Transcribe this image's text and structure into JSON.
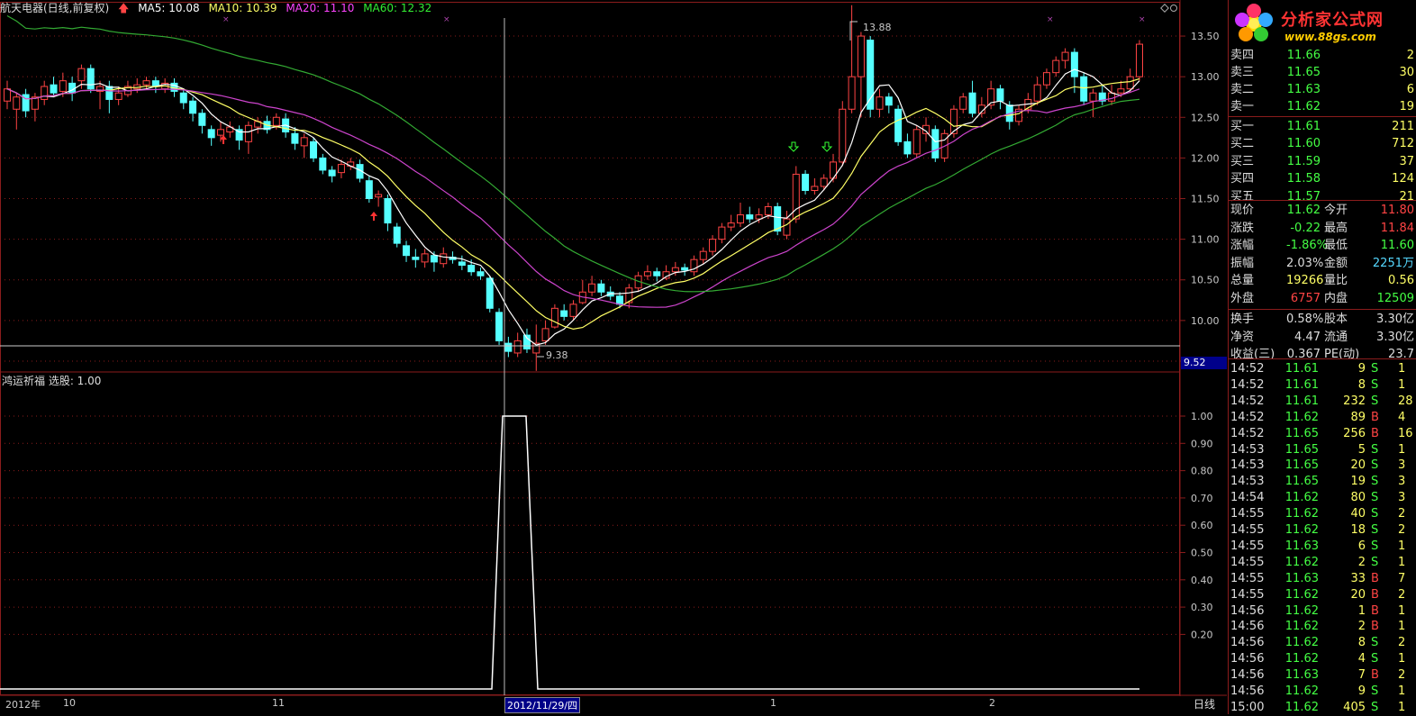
{
  "header": {
    "stock": "航天电器(日线,前复权)",
    "ma5": "MA5: 10.08",
    "ma10": "MA10: 10.39",
    "ma20": "MA20: 11.10",
    "ma60": "MA60: 12.32",
    "arrow_icon": "up-arrow-icon"
  },
  "main_axis": [
    "13.50",
    "13.00",
    "12.50",
    "12.00",
    "11.50",
    "11.00",
    "10.50",
    "10.00",
    "9.50"
  ],
  "current_price_tag": "9.52",
  "annotations": {
    "high": "13.88",
    "low": "9.38"
  },
  "sub_panel": {
    "title": "鸿运祈福 选股: 1.00",
    "axis": [
      "1.00",
      "0.90",
      "0.80",
      "0.70",
      "0.60",
      "0.50",
      "0.40",
      "0.30",
      "0.20"
    ]
  },
  "date_bar": {
    "year": "2012年",
    "m10": "10",
    "m11": "11",
    "selected": "2012/11/29/四",
    "m1": "1",
    "m2": "2",
    "period_button": "日线"
  },
  "logo": {
    "title": "分析家公式网",
    "url": "www.88gs.com"
  },
  "order_book": {
    "asks": [
      {
        "label": "卖四",
        "price": "11.66",
        "qty": "2"
      },
      {
        "label": "卖三",
        "price": "11.65",
        "qty": "30"
      },
      {
        "label": "卖二",
        "price": "11.63",
        "qty": "6"
      },
      {
        "label": "卖一",
        "price": "11.62",
        "qty": "19"
      }
    ],
    "bids": [
      {
        "label": "买一",
        "price": "11.61",
        "qty": "211"
      },
      {
        "label": "买二",
        "price": "11.60",
        "qty": "712"
      },
      {
        "label": "买三",
        "price": "11.59",
        "qty": "37"
      },
      {
        "label": "买四",
        "price": "11.58",
        "qty": "124"
      },
      {
        "label": "买五",
        "price": "11.57",
        "qty": "21"
      }
    ]
  },
  "quote": [
    {
      "k1": "现价",
      "v1": "11.62",
      "k2": "今开",
      "v2": "11.80"
    },
    {
      "k1": "涨跌",
      "v1": "-0.22",
      "k2": "最高",
      "v2": "11.84"
    },
    {
      "k1": "涨幅",
      "v1": "-1.86%",
      "k2": "最低",
      "v2": "11.60"
    },
    {
      "k1": "振幅",
      "v1": "2.03%",
      "k2": "金额",
      "v2": "2251万"
    },
    {
      "k1": "总量",
      "v1": "19266",
      "k2": "量比",
      "v2": "0.56"
    },
    {
      "k1": "外盘",
      "v1": "6757",
      "k2": "内盘",
      "v2": "12509"
    },
    {
      "k1": "换手",
      "v1": "0.58%",
      "k2": "股本",
      "v2": "3.30亿"
    },
    {
      "k1": "净资",
      "v1": "4.47",
      "k2": "流通",
      "v2": "3.30亿"
    },
    {
      "k1": "收益(三)",
      "v1": "0.367",
      "k2": "PE(动)",
      "v2": "23.7"
    }
  ],
  "ticks": [
    {
      "t": "14:52",
      "p": "11.61",
      "v": "9",
      "bs": "S",
      "n": "1"
    },
    {
      "t": "14:52",
      "p": "11.61",
      "v": "8",
      "bs": "S",
      "n": "1"
    },
    {
      "t": "14:52",
      "p": "11.61",
      "v": "232",
      "bs": "S",
      "n": "28"
    },
    {
      "t": "14:52",
      "p": "11.62",
      "v": "89",
      "bs": "B",
      "n": "4"
    },
    {
      "t": "14:52",
      "p": "11.65",
      "v": "256",
      "bs": "B",
      "n": "16"
    },
    {
      "t": "14:53",
      "p": "11.65",
      "v": "5",
      "bs": "S",
      "n": "1"
    },
    {
      "t": "14:53",
      "p": "11.65",
      "v": "20",
      "bs": "S",
      "n": "3"
    },
    {
      "t": "14:53",
      "p": "11.65",
      "v": "19",
      "bs": "S",
      "n": "3"
    },
    {
      "t": "14:54",
      "p": "11.62",
      "v": "80",
      "bs": "S",
      "n": "3"
    },
    {
      "t": "14:55",
      "p": "11.62",
      "v": "40",
      "bs": "S",
      "n": "2"
    },
    {
      "t": "14:55",
      "p": "11.62",
      "v": "18",
      "bs": "S",
      "n": "2"
    },
    {
      "t": "14:55",
      "p": "11.63",
      "v": "6",
      "bs": "S",
      "n": "1"
    },
    {
      "t": "14:55",
      "p": "11.62",
      "v": "2",
      "bs": "S",
      "n": "1"
    },
    {
      "t": "14:55",
      "p": "11.63",
      "v": "33",
      "bs": "B",
      "n": "7"
    },
    {
      "t": "14:55",
      "p": "11.62",
      "v": "20",
      "bs": "B",
      "n": "2"
    },
    {
      "t": "14:56",
      "p": "11.62",
      "v": "1",
      "bs": "B",
      "n": "1"
    },
    {
      "t": "14:56",
      "p": "11.62",
      "v": "2",
      "bs": "B",
      "n": "1"
    },
    {
      "t": "14:56",
      "p": "11.62",
      "v": "8",
      "bs": "S",
      "n": "2"
    },
    {
      "t": "14:56",
      "p": "11.62",
      "v": "4",
      "bs": "S",
      "n": "1"
    },
    {
      "t": "14:56",
      "p": "11.63",
      "v": "7",
      "bs": "B",
      "n": "2"
    },
    {
      "t": "14:56",
      "p": "11.62",
      "v": "9",
      "bs": "S",
      "n": "1"
    },
    {
      "t": "15:00",
      "p": "11.62",
      "v": "405",
      "bs": "S",
      "n": "1"
    }
  ],
  "chart_data": {
    "type": "candlestick",
    "ylim": [
      9.4,
      13.7
    ],
    "candles": [
      [
        12.7,
        12.85,
        12.95,
        12.6
      ],
      [
        12.6,
        12.75,
        12.8,
        12.35
      ],
      [
        12.78,
        12.58,
        12.85,
        12.5
      ],
      [
        12.6,
        12.75,
        12.8,
        12.45
      ],
      [
        12.72,
        12.88,
        12.95,
        12.65
      ],
      [
        12.9,
        12.8,
        13.0,
        12.75
      ],
      [
        12.82,
        12.95,
        13.05,
        12.75
      ],
      [
        12.92,
        12.8,
        13.0,
        12.7
      ],
      [
        12.95,
        13.1,
        13.15,
        12.85
      ],
      [
        13.1,
        12.85,
        13.15,
        12.8
      ],
      [
        12.82,
        12.88,
        12.95,
        12.6
      ],
      [
        12.88,
        12.72,
        12.95,
        12.55
      ],
      [
        12.72,
        12.8,
        12.88,
        12.65
      ],
      [
        12.78,
        12.88,
        12.95,
        12.75
      ],
      [
        12.85,
        12.9,
        12.98,
        12.8
      ],
      [
        12.9,
        12.95,
        13.0,
        12.85
      ],
      [
        12.95,
        12.88,
        13.0,
        12.8
      ],
      [
        12.85,
        12.92,
        12.98,
        12.8
      ],
      [
        12.92,
        12.82,
        12.98,
        12.75
      ],
      [
        12.8,
        12.68,
        12.85,
        12.6
      ],
      [
        12.7,
        12.55,
        12.75,
        12.45
      ],
      [
        12.55,
        12.4,
        12.6,
        12.3
      ],
      [
        12.35,
        12.25,
        12.4,
        12.15
      ],
      [
        12.28,
        12.35,
        12.45,
        12.2
      ],
      [
        12.32,
        12.38,
        12.45,
        12.25
      ],
      [
        12.35,
        12.22,
        12.4,
        12.1
      ],
      [
        12.2,
        12.4,
        12.45,
        12.05
      ],
      [
        12.38,
        12.45,
        12.5,
        12.3
      ],
      [
        12.45,
        12.35,
        12.52,
        12.3
      ],
      [
        12.4,
        12.5,
        12.55,
        12.35
      ],
      [
        12.48,
        12.32,
        12.55,
        12.25
      ],
      [
        12.3,
        12.18,
        12.38,
        12.1
      ],
      [
        12.15,
        12.25,
        12.3,
        12.0
      ],
      [
        12.2,
        12.0,
        12.25,
        11.95
      ],
      [
        12.0,
        11.85,
        12.05,
        11.8
      ],
      [
        11.85,
        11.78,
        11.9,
        11.7
      ],
      [
        11.82,
        11.92,
        11.98,
        11.75
      ],
      [
        11.9,
        11.95,
        12.0,
        11.85
      ],
      [
        11.92,
        11.75,
        11.98,
        11.7
      ],
      [
        11.72,
        11.5,
        11.78,
        11.45
      ],
      [
        11.52,
        11.55,
        11.6,
        11.4
      ],
      [
        11.5,
        11.2,
        11.55,
        11.1
      ],
      [
        11.15,
        10.95,
        11.2,
        10.9
      ],
      [
        10.92,
        10.8,
        10.98,
        10.72
      ],
      [
        10.78,
        10.75,
        10.88,
        10.65
      ],
      [
        10.72,
        10.82,
        10.88,
        10.65
      ],
      [
        10.8,
        10.72,
        10.85,
        10.6
      ],
      [
        10.7,
        10.82,
        10.9,
        10.65
      ],
      [
        10.78,
        10.75,
        10.85,
        10.7
      ],
      [
        10.72,
        10.68,
        10.8,
        10.62
      ],
      [
        10.68,
        10.6,
        10.75,
        10.55
      ],
      [
        10.6,
        10.55,
        10.65,
        10.5
      ],
      [
        10.52,
        10.15,
        10.55,
        10.1
      ],
      [
        10.1,
        9.75,
        10.15,
        9.7
      ],
      [
        9.72,
        9.62,
        9.8,
        9.55
      ],
      [
        9.6,
        9.75,
        9.85,
        9.55
      ],
      [
        9.82,
        9.65,
        9.9,
        9.6
      ],
      [
        9.6,
        9.72,
        9.95,
        9.38
      ],
      [
        9.75,
        9.9,
        10.0,
        9.7
      ],
      [
        9.92,
        10.15,
        10.2,
        9.9
      ],
      [
        10.12,
        10.05,
        10.2,
        10.0
      ],
      [
        10.05,
        10.2,
        10.25,
        10.0
      ],
      [
        10.22,
        10.35,
        10.5,
        10.2
      ],
      [
        10.35,
        10.45,
        10.55,
        10.3
      ],
      [
        10.45,
        10.35,
        10.5,
        10.3
      ],
      [
        10.35,
        10.3,
        10.42,
        10.25
      ],
      [
        10.3,
        10.2,
        10.35,
        10.15
      ],
      [
        10.22,
        10.4,
        10.45,
        10.15
      ],
      [
        10.4,
        10.55,
        10.6,
        10.35
      ],
      [
        10.55,
        10.6,
        10.68,
        10.5
      ],
      [
        10.6,
        10.55,
        10.65,
        10.48
      ],
      [
        10.52,
        10.6,
        10.68,
        10.5
      ],
      [
        10.6,
        10.65,
        10.72,
        10.55
      ],
      [
        10.65,
        10.62,
        10.7,
        10.55
      ],
      [
        10.6,
        10.75,
        10.8,
        10.55
      ],
      [
        10.75,
        10.85,
        10.9,
        10.7
      ],
      [
        10.85,
        11.0,
        11.05,
        10.8
      ],
      [
        11.0,
        11.15,
        11.2,
        10.95
      ],
      [
        11.15,
        11.2,
        11.3,
        11.1
      ],
      [
        11.2,
        11.3,
        11.45,
        11.15
      ],
      [
        11.3,
        11.25,
        11.4,
        11.2
      ],
      [
        11.25,
        11.3,
        11.38,
        11.2
      ],
      [
        11.3,
        11.4,
        11.45,
        11.25
      ],
      [
        11.4,
        11.1,
        11.45,
        11.05
      ],
      [
        11.05,
        11.25,
        11.35,
        11.0
      ],
      [
        11.25,
        11.8,
        11.9,
        11.2
      ],
      [
        11.8,
        11.6,
        11.85,
        11.55
      ],
      [
        11.6,
        11.65,
        11.75,
        11.55
      ],
      [
        11.65,
        11.75,
        11.8,
        11.6
      ],
      [
        11.75,
        11.95,
        12.05,
        11.7
      ],
      [
        11.95,
        12.6,
        12.7,
        11.9
      ],
      [
        12.6,
        13.0,
        13.88,
        12.55
      ],
      [
        13.0,
        13.5,
        13.55,
        12.5
      ],
      [
        13.45,
        12.6,
        13.5,
        12.5
      ],
      [
        12.6,
        12.75,
        12.85,
        12.5
      ],
      [
        12.75,
        12.65,
        12.8,
        12.55
      ],
      [
        12.6,
        12.2,
        12.65,
        12.15
      ],
      [
        12.2,
        12.05,
        12.3,
        12.0
      ],
      [
        12.05,
        12.35,
        12.4,
        12.0
      ],
      [
        12.3,
        12.4,
        12.5,
        12.2
      ],
      [
        12.35,
        12.0,
        12.4,
        11.95
      ],
      [
        12.0,
        12.3,
        12.35,
        11.95
      ],
      [
        12.3,
        12.6,
        12.65,
        12.25
      ],
      [
        12.6,
        12.75,
        12.8,
        12.55
      ],
      [
        12.8,
        12.55,
        12.95,
        12.5
      ],
      [
        12.55,
        12.65,
        12.75,
        12.5
      ],
      [
        12.65,
        12.85,
        12.95,
        12.6
      ],
      [
        12.85,
        12.7,
        12.9,
        12.6
      ],
      [
        12.65,
        12.45,
        12.7,
        12.35
      ],
      [
        12.45,
        12.6,
        12.65,
        12.4
      ],
      [
        12.6,
        12.72,
        12.8,
        12.55
      ],
      [
        12.7,
        12.9,
        13.0,
        12.65
      ],
      [
        12.9,
        13.05,
        13.1,
        12.85
      ],
      [
        13.05,
        13.2,
        13.25,
        13.0
      ],
      [
        13.2,
        13.3,
        13.35,
        13.1
      ],
      [
        13.3,
        13.0,
        13.35,
        12.8
      ],
      [
        13.0,
        12.7,
        13.05,
        12.65
      ],
      [
        12.7,
        12.8,
        12.85,
        12.5
      ],
      [
        12.8,
        12.7,
        12.9,
        12.65
      ],
      [
        12.7,
        12.8,
        12.9,
        12.65
      ],
      [
        12.8,
        12.85,
        12.95,
        12.75
      ],
      [
        12.85,
        13.0,
        13.1,
        12.8
      ],
      [
        13.0,
        13.4,
        13.45,
        12.95
      ]
    ],
    "signal_index": 57
  }
}
